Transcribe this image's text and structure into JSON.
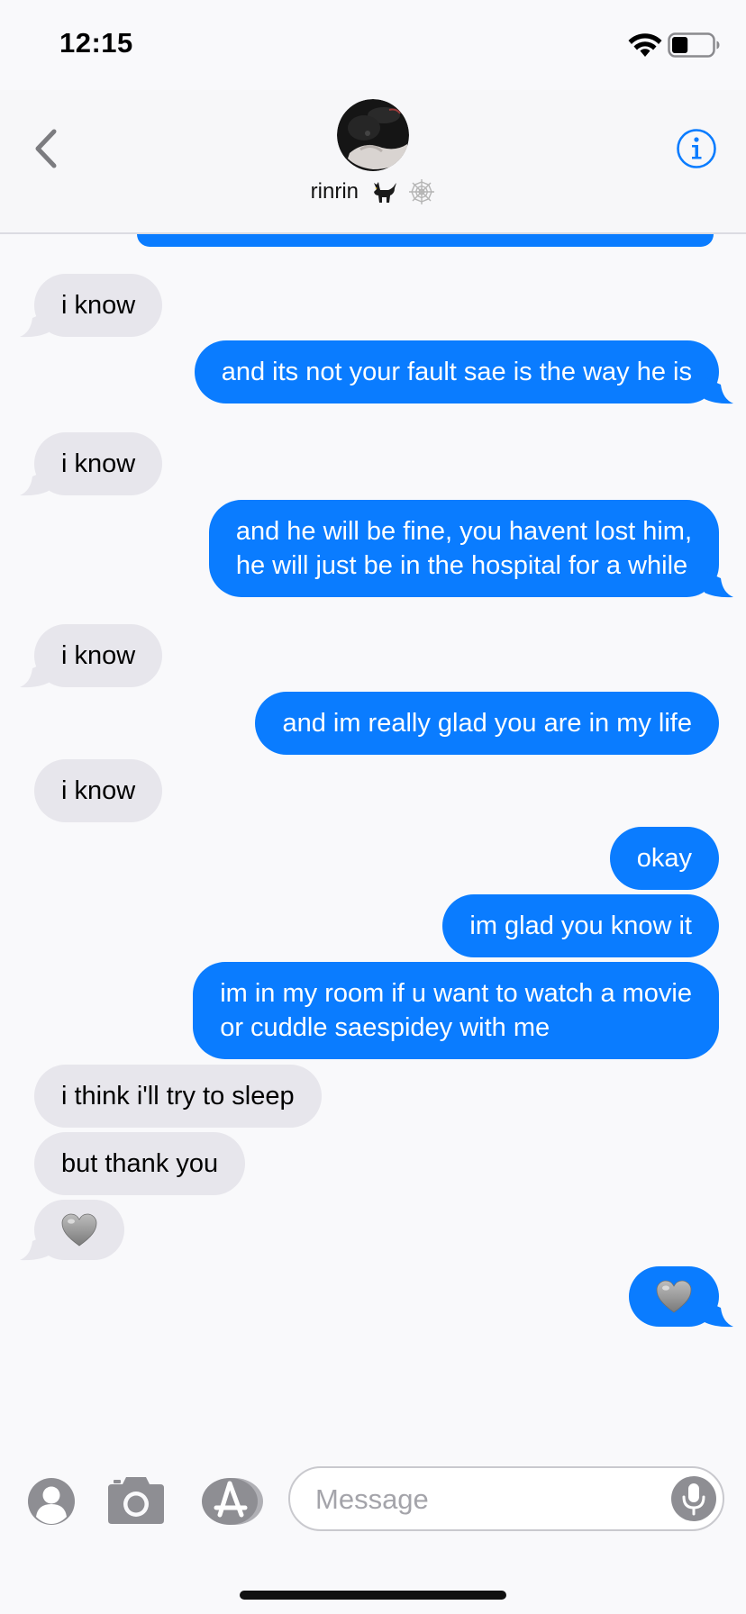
{
  "status_bar": {
    "time": "12:15",
    "battery_level": 0.4,
    "icons": [
      "wifi-icon",
      "battery-icon"
    ]
  },
  "header": {
    "contact_name": "rinrin",
    "name_emojis": [
      "black-cat-emoji",
      "spider-web-emoji"
    ],
    "back_icon": "chevron-left-icon",
    "info_icon": "info-circle-icon"
  },
  "thread": {
    "messages": [
      {
        "dir": "in",
        "text": "i know"
      },
      {
        "dir": "out",
        "text": "and its not your fault sae is the way he is"
      },
      {
        "dir": "in",
        "text": "i know"
      },
      {
        "dir": "out",
        "lines": [
          "and he will be fine, you havent lost him,",
          "he will just be in the hospital for a while"
        ]
      },
      {
        "dir": "in",
        "text": "i know"
      },
      {
        "dir": "out",
        "text": "and im really glad you are in my life"
      },
      {
        "dir": "in",
        "text": "i know"
      },
      {
        "dir": "out",
        "text": "okay"
      },
      {
        "dir": "out",
        "text": "im glad you know it"
      },
      {
        "dir": "out",
        "lines": [
          "im in my room if u want to watch a movie",
          "or cuddle saespidey with me"
        ]
      },
      {
        "dir": "in",
        "text": "i think i'll try to sleep"
      },
      {
        "dir": "in",
        "text": "but thank you"
      },
      {
        "dir": "in",
        "emoji": "grey-heart-emoji"
      },
      {
        "dir": "out",
        "emoji": "grey-heart-emoji"
      }
    ]
  },
  "input_bar": {
    "placeholder": "Message",
    "icons": [
      "contacts-icon",
      "camera-icon",
      "app-store-icon",
      "microphone-icon"
    ]
  },
  "colors": {
    "outgoing_bubble": "#0a7cff",
    "incoming_bubble": "#e7e6ec",
    "accent": "#0a7cff",
    "background": "#f9f9fb"
  }
}
